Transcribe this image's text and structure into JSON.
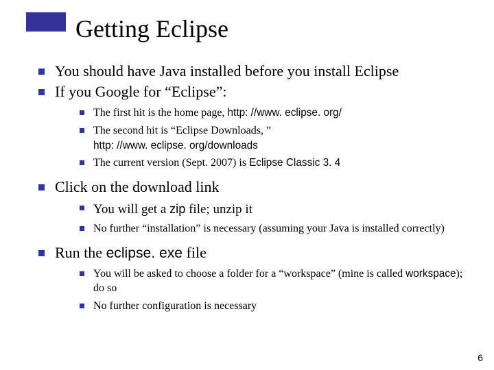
{
  "title": "Getting Eclipse",
  "bullets": {
    "b1": "You should have Java installed before you install Eclipse",
    "b2": "If you Google for “Eclipse”:",
    "b2a_pre": "The first hit is the home page, ",
    "b2a_url": "http: //www. eclipse. org/",
    "b2b_pre": "The second hit is “Eclipse Downloads, ” ",
    "b2b_url": "http: //www. eclipse. org/downloads",
    "b2c_pre": "The current version (Sept. 2007) is ",
    "b2c_mono": "Eclipse Classic 3. 4",
    "b3": "Click on the download link",
    "b3a_pre": "You will get a ",
    "b3a_mono": "zip",
    "b3a_post": " file; unzip it",
    "b3b": "No further “installation” is necessary (assuming your Java is installed correctly)",
    "b4_pre": "Run the ",
    "b4_mono": "eclipse. exe",
    "b4_post": " file",
    "b4a_pre": "You will be asked to choose a folder for a “workspace” (mine is called ",
    "b4a_mono": "workspace",
    "b4a_post": "); do so",
    "b4b": "No further configuration is necessary"
  },
  "page_number": "6"
}
